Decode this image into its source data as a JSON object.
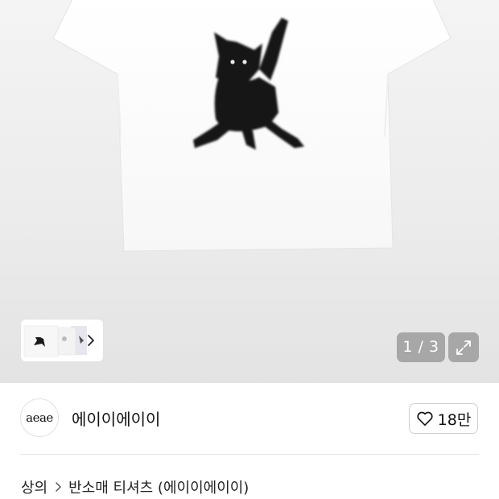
{
  "gallery": {
    "counter": "1 / 3",
    "current_image": 1,
    "total_images": 3
  },
  "brand": {
    "logo_text": "aeae",
    "name": "에이이에이이",
    "like_count": "18만"
  },
  "breadcrumb": {
    "items": [
      "상의",
      "반소매 티셔츠 (에이이에이이)"
    ]
  },
  "icons": {
    "thumb_next": "chevron-right-icon",
    "expand": "expand-icon",
    "like": "heart-outline-icon",
    "breadcrumb_separator": "chevron-right-icon"
  }
}
